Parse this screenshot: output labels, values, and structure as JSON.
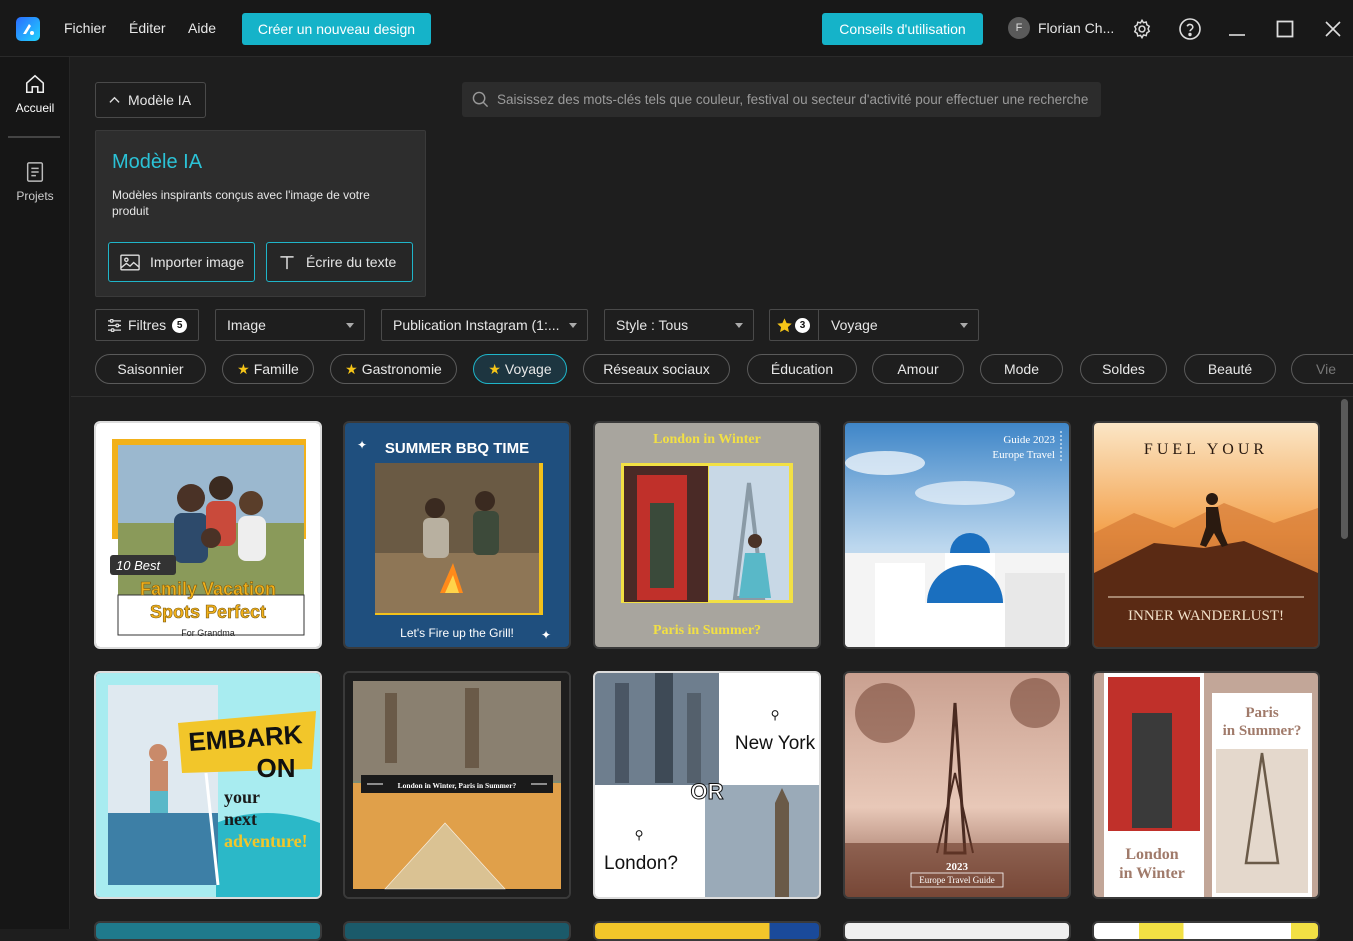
{
  "titlebar": {
    "menu": [
      "Fichier",
      "Éditer",
      "Aide"
    ],
    "new_design": "Créer un nouveau design",
    "tips": "Conseils d'utilisation",
    "user_initial": "F",
    "user_name": "Florian Ch..."
  },
  "sidebar": {
    "home": "Accueil",
    "projects": "Projets"
  },
  "ai_toggle": "Modèle IA",
  "search": {
    "placeholder": "Saisissez des mots-clés tels que couleur, festival ou secteur d'activité pour effectuer une recherche"
  },
  "ai_card": {
    "title": "Modèle IA",
    "desc": "Modèles inspirants conçus avec l'image de votre produit",
    "import_btn": "Importer image",
    "write_btn": "Écrire du texte"
  },
  "filters": {
    "label": "Filtres",
    "count": "5",
    "type": "Image",
    "format": "Publication Instagram (1:...",
    "style": "Style : Tous",
    "fav_count": "3",
    "theme": "Voyage"
  },
  "chips": [
    "Saisonnier",
    "Famille",
    "Gastronomie",
    "Voyage",
    "Réseaux sociaux",
    "Éducation",
    "Amour",
    "Mode",
    "Soldes",
    "Beauté",
    "Vie"
  ],
  "templates": {
    "t1": {
      "a": "10 Best",
      "b": "Family Vacation",
      "c": "Spots Perfect",
      "d": "For Grandma"
    },
    "t2": {
      "a": "SUMMER BBQ TIME",
      "b": "Let's Fire up the Grill!"
    },
    "t3": {
      "a": "London in Winter",
      "b": "Paris in Summer?"
    },
    "t4": {
      "a": "Guide 2023",
      "b": "Europe Travel"
    },
    "t5": {
      "a": "FUEL YOUR",
      "b": "INNER WANDERLUST!"
    },
    "t6": {
      "a": "EMBARK",
      "b": "ON",
      "c": "your",
      "d": "next",
      "e": "adventure!"
    },
    "t7": {
      "a": "London in Winter, Paris in Summer?"
    },
    "t8": {
      "a": "New York",
      "b": "OR",
      "c": "London?"
    },
    "t9": {
      "a": "2023",
      "b": "Europe Travel Guide"
    },
    "t10": {
      "a": "Paris",
      "b": "in Summer?",
      "c": "London",
      "d": "in Winter"
    }
  }
}
